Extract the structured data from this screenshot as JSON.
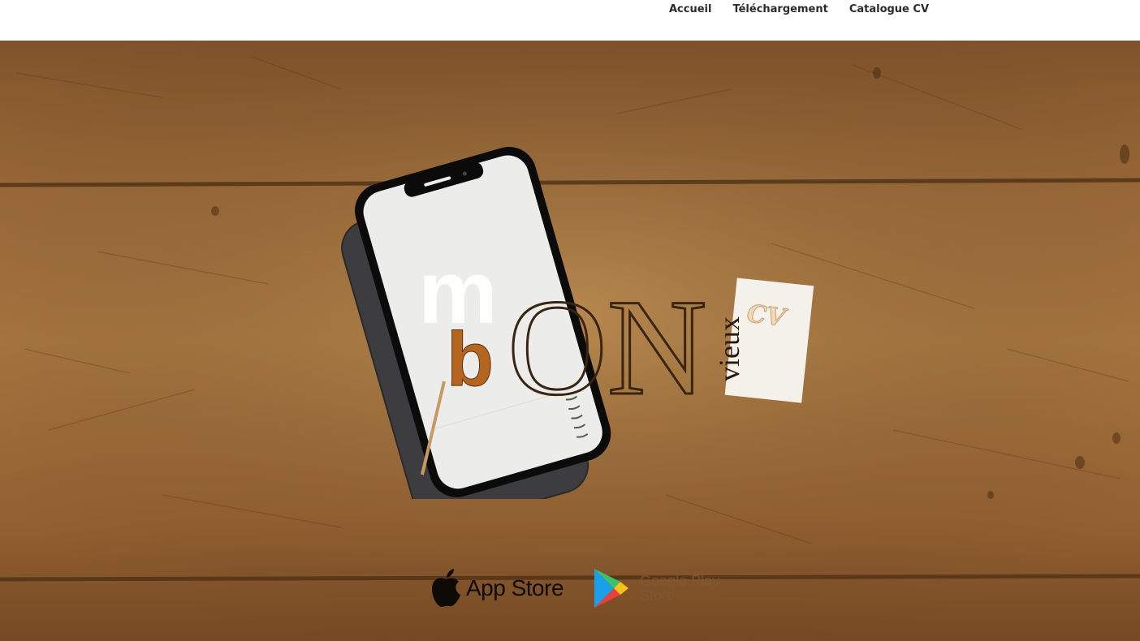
{
  "nav": {
    "items": [
      {
        "label": "Accueil"
      },
      {
        "label": "Téléchargement"
      },
      {
        "label": "Catalogue CV"
      }
    ]
  },
  "logo": {
    "letter_m": "m",
    "letter_b": "b",
    "word_on": "ON",
    "word_vieux": "vieux",
    "word_cv": "CV"
  },
  "badges": {
    "appstore_label": "App Store",
    "gplay_line1": "Google Play",
    "gplay_line2": "Store"
  },
  "colors": {
    "wood_dark": "#6b4220",
    "wood_mid": "#a8743f",
    "b_letter": "#b5651d"
  },
  "icons": [
    "apple-icon",
    "google-play-icon"
  ]
}
